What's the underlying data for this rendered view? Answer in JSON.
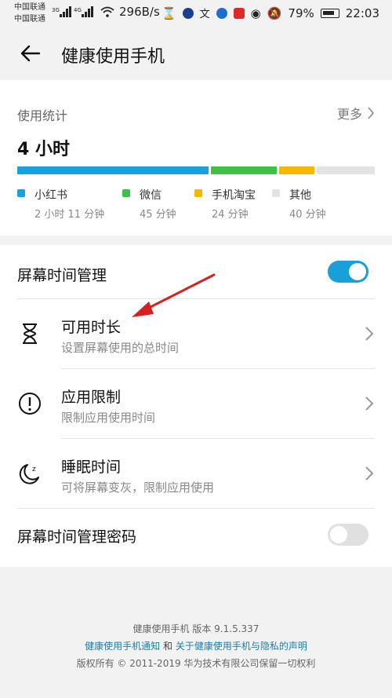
{
  "status_bar": {
    "carrier_1": "中国联通",
    "carrier_2": "中国联通",
    "speed": "296B/s",
    "battery": "79%",
    "time": "22:03"
  },
  "header": {
    "title": "健康使用手机"
  },
  "usage": {
    "label": "使用统计",
    "more": "更多",
    "total": "4 小时",
    "apps": [
      {
        "name": "小红书",
        "duration": "2 小时 11 分钟",
        "minutes": 131,
        "color": "#16a1e0"
      },
      {
        "name": "微信",
        "duration": "45 分钟",
        "minutes": 45,
        "color": "#3dc14a"
      },
      {
        "name": "手机淘宝",
        "duration": "24 分钟",
        "minutes": 24,
        "color": "#f5b800"
      },
      {
        "name": "其他",
        "duration": "40 分钟",
        "minutes": 40,
        "color": "#e3e3e3"
      }
    ]
  },
  "settings": {
    "screen_time": {
      "title": "屏幕时间管理",
      "enabled": true
    },
    "available_time": {
      "title": "可用时长",
      "subtitle": "设置屏幕使用的总时间"
    },
    "app_limit": {
      "title": "应用限制",
      "subtitle": "限制应用使用时间"
    },
    "sleep_time": {
      "title": "睡眠时间",
      "subtitle": "可将屏幕变灰，限制应用使用"
    },
    "password": {
      "title": "屏幕时间管理密码",
      "enabled": false
    }
  },
  "footer": {
    "version": "健康使用手机  版本  9.1.5.337",
    "link_notice": "健康使用手机通知",
    "and": " 和 ",
    "link_privacy": "关于健康使用手机与隐私的声明",
    "copyright": "版权所有 © 2011-2019 华为技术有限公司保留一切权利"
  },
  "colors": {
    "accent": "#1aa0d8",
    "toggle_off": "#e0e0e0",
    "annotation_arrow": "#d9201f"
  }
}
